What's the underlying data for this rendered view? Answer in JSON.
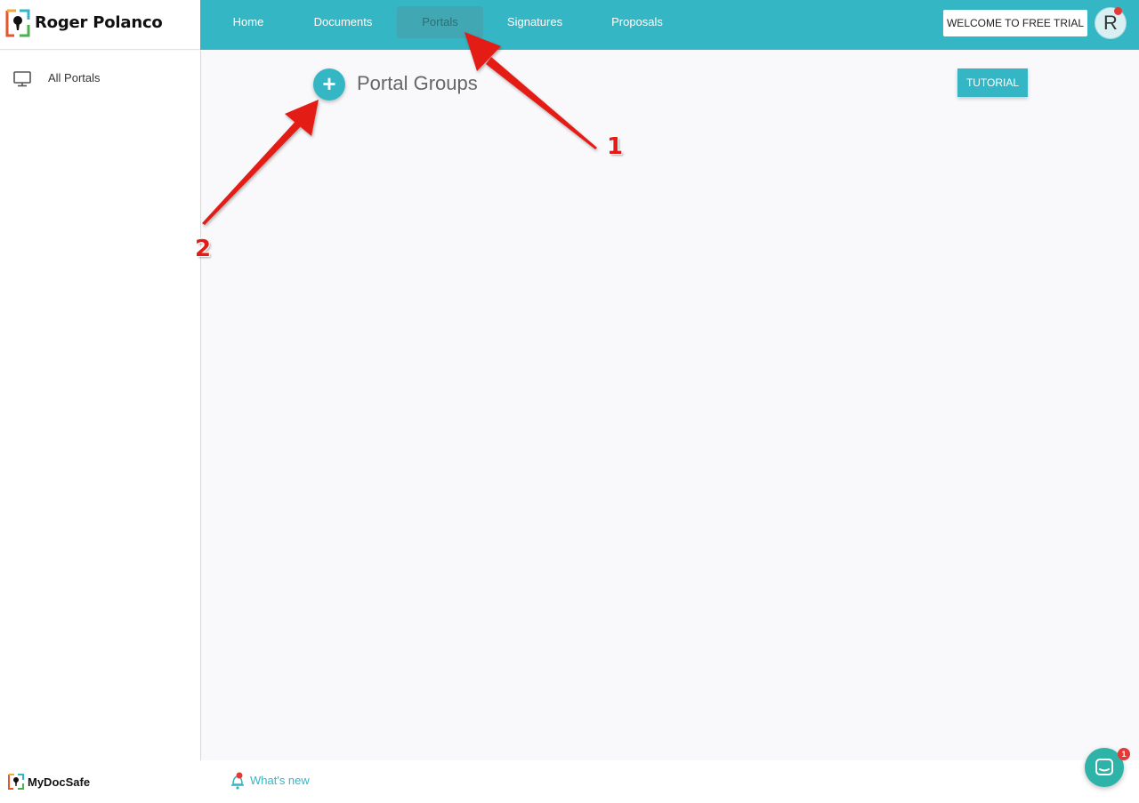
{
  "brand": {
    "name": "Roger Polanco"
  },
  "nav": {
    "items": [
      {
        "label": "Home"
      },
      {
        "label": "Documents"
      },
      {
        "label": "Portals",
        "active": true
      },
      {
        "label": "Signatures"
      },
      {
        "label": "Proposals"
      }
    ]
  },
  "header": {
    "trial_label": "WELCOME TO FREE TRIAL",
    "avatar_initial": "R"
  },
  "sidebar": {
    "items": [
      {
        "label": "All Portals",
        "icon": "monitor-icon"
      }
    ]
  },
  "main": {
    "title": "Portal Groups",
    "add_label": "+",
    "tutorial_label": "TUTORIAL"
  },
  "annotations": {
    "one": "1",
    "two": "2"
  },
  "footer": {
    "brand": "MyDocSafe",
    "whats_new": "What's new",
    "chat_badge": "1"
  },
  "colors": {
    "accent": "#35b6c4",
    "annotation": "#e41b17",
    "chat": "#2db3a7",
    "notification": "#e53935"
  }
}
